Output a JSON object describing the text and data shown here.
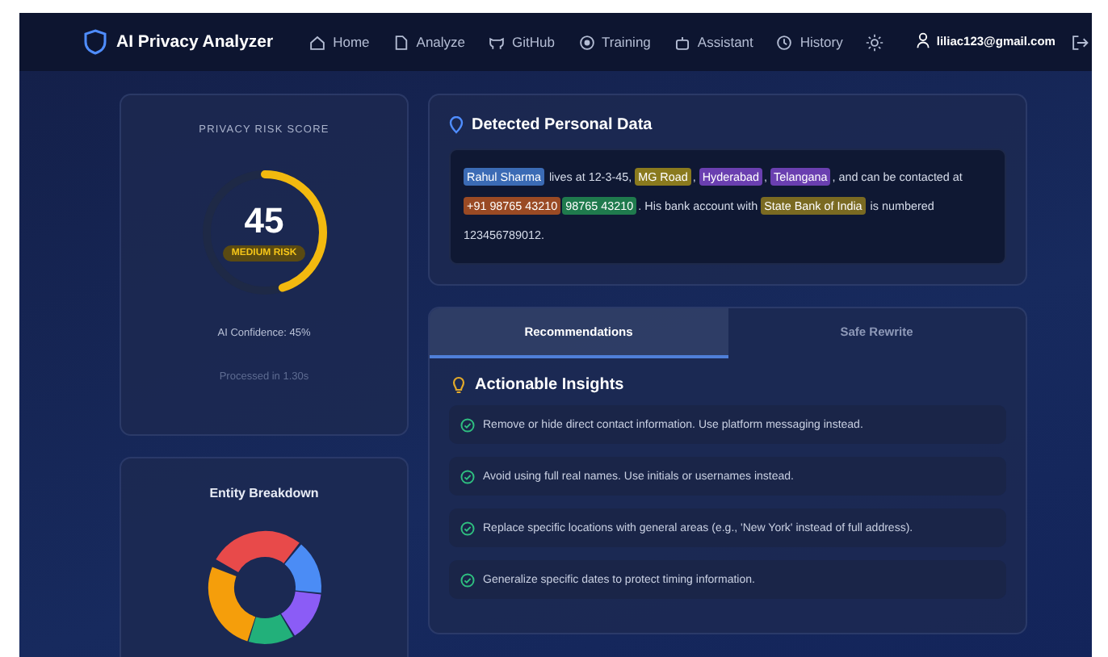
{
  "nav": {
    "brand": "AI Privacy Analyzer",
    "items": [
      {
        "label": "Home"
      },
      {
        "label": "Analyze"
      },
      {
        "label": "GitHub"
      },
      {
        "label": "Training"
      },
      {
        "label": "Assistant"
      },
      {
        "label": "History"
      }
    ],
    "user": "liliac123@gmail.com"
  },
  "score_card": {
    "title": "PRIVACY RISK SCORE",
    "score": "45",
    "level": 0.45,
    "badge": "MEDIUM RISK",
    "confidence": "AI Confidence: 45%",
    "processed": "Processed in 1.30s"
  },
  "entity_card": {
    "title": "Entity Breakdown"
  },
  "detected": {
    "title": "Detected Personal Data",
    "segments": [
      {
        "text": "Rahul Sharma",
        "color": "#3b6bb5"
      },
      {
        "text": " lives at 12-3-45, "
      },
      {
        "text": "MG Road",
        "color": "#8a7a1e"
      },
      {
        "text": ", "
      },
      {
        "text": "Hyderabad",
        "color": "#6a3fb0"
      },
      {
        "text": ", "
      },
      {
        "text": "Telangana",
        "color": "#6a3fb0"
      },
      {
        "text": ", and can be contacted at "
      },
      {
        "text": "+91 98765 43210",
        "color": "#9a4a24"
      },
      {
        "text": "98765 43210",
        "color": "#1f7a4d"
      },
      {
        "text": ". His bank account with "
      },
      {
        "text": "State Bank of India",
        "color": "#7a6a22"
      },
      {
        "text": " is numbered 123456789012."
      }
    ]
  },
  "tabs": [
    {
      "label": "Recommendations",
      "selected": true
    },
    {
      "label": "Safe Rewrite",
      "selected": false
    }
  ],
  "insights": {
    "title": "Actionable Insights",
    "items": [
      "Remove or hide direct contact information. Use platform messaging instead.",
      "Avoid using full real names. Use initials or usernames instead.",
      "Replace specific locations with general areas (e.g., 'New York' instead of full address).",
      "Generalize specific dates to protect timing information."
    ]
  }
}
